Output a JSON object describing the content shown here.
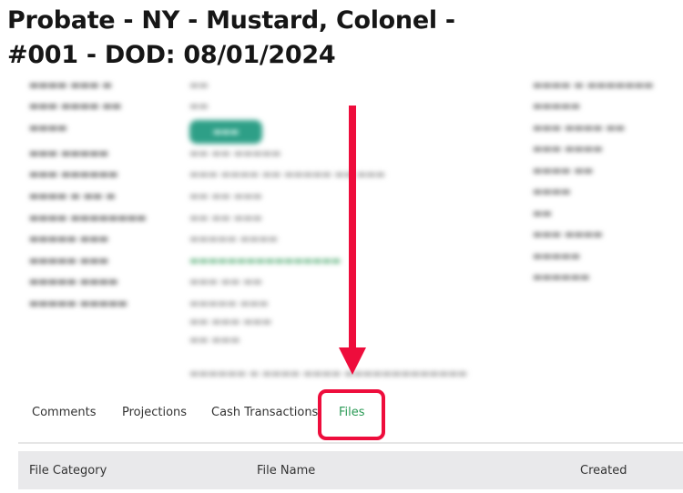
{
  "header": {
    "title": "Probate - NY - Mustard, Colonel - #001 - DOD: 08/01/2024"
  },
  "tabs": [
    {
      "label": "Comments"
    },
    {
      "label": "Projections"
    },
    {
      "label": "Cash Transactions"
    },
    {
      "label": "Files",
      "active": true
    }
  ],
  "files_table": {
    "columns": [
      "File Category",
      "File Name",
      "Created"
    ]
  },
  "colors": {
    "active_tab": "#2a9a55",
    "annotation": "#ee0d3c",
    "status_pill": "#2e9f87"
  }
}
